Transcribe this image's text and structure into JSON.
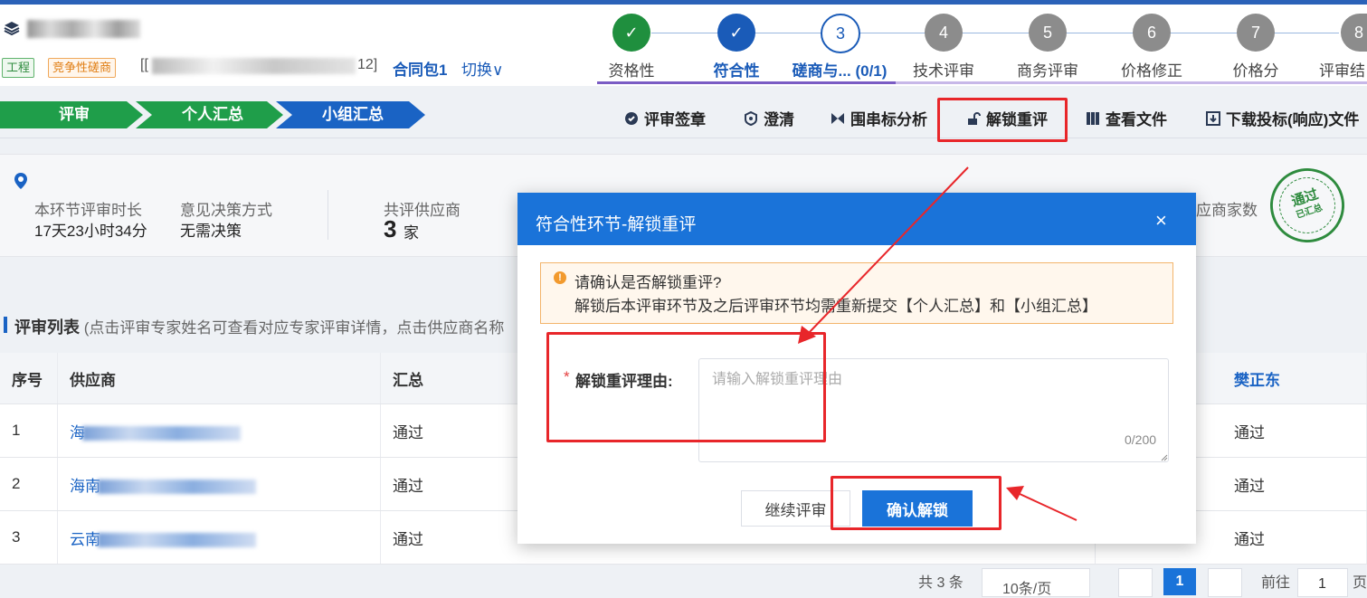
{
  "header": {
    "tags": [
      "工程",
      "竞争性磋商"
    ],
    "project_code_prefix": "[[",
    "project_code_suffix": "12]",
    "package": "合同包1",
    "switch": "切换"
  },
  "steps": [
    {
      "num": "✓",
      "label": "资格性",
      "state": "done"
    },
    {
      "num": "✓",
      "label": "符合性",
      "state": "current"
    },
    {
      "num": "3",
      "label": "磋商与... (0/1)",
      "state": "next"
    },
    {
      "num": "4",
      "label": "技术评审",
      "state": "todo"
    },
    {
      "num": "5",
      "label": "商务评审",
      "state": "todo"
    },
    {
      "num": "6",
      "label": "价格修正",
      "state": "todo"
    },
    {
      "num": "7",
      "label": "价格分",
      "state": "todo"
    },
    {
      "num": "8",
      "label": "评审结",
      "state": "todo"
    }
  ],
  "crumbs": [
    "评审",
    "个人汇总",
    "小组汇总"
  ],
  "toolbar": [
    "评审签章",
    "澄清",
    "围串标分析",
    "解锁重评",
    "查看文件",
    "下载投标(响应)文件"
  ],
  "info": {
    "duration_label": "本环节评审时长",
    "duration_value": "17天23小时34分",
    "decision_label": "意见决策方式",
    "decision_value": "无需决策",
    "suppliers_label": "共评供应商",
    "suppliers_value": "3",
    "suppliers_unit": "家",
    "right_label": "应商家数",
    "stamp_top": "通过",
    "stamp_bottom": "已汇总"
  },
  "list": {
    "title": "评审列表",
    "hint": "(点击评审专家姓名可查看对应专家评审详情，点击供应商名称",
    "columns": [
      "序号",
      "供应商",
      "汇总",
      "樊正东"
    ],
    "rows": [
      {
        "no": "1",
        "supplier_prefix": "海",
        "summary": "通过",
        "expert": "通过"
      },
      {
        "no": "2",
        "supplier_prefix": "海南",
        "summary": "通过",
        "expert": "通过"
      },
      {
        "no": "3",
        "supplier_prefix": "云南",
        "summary": "通过",
        "expert": "通过"
      }
    ]
  },
  "pager": {
    "total": "共 3 条",
    "size": "10条/页",
    "current": "1",
    "goto": "前往",
    "goto_value": "1",
    "page_unit": "页"
  },
  "dialog": {
    "title": "符合性环节-解锁重评",
    "close": "×",
    "alert_line1": "请确认是否解锁重评?",
    "alert_line2": "解锁后本评审环节及之后评审环节均需重新提交【个人汇总】和【小组汇总】",
    "field_required": "*",
    "field_label": "解锁重评理由:",
    "placeholder": "请输入解锁重评理由",
    "counter": "0/200",
    "cancel": "继续评审",
    "confirm": "确认解锁"
  },
  "colors": {
    "primary": "#1a73d9",
    "green": "#1f8f3e",
    "annotation": "#e8262a"
  }
}
